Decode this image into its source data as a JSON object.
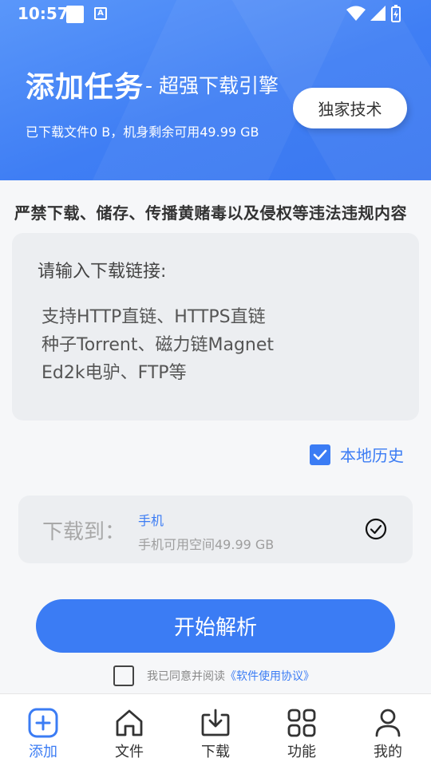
{
  "status_bar": {
    "time": "10:57"
  },
  "header": {
    "title": "添加任务",
    "subtitle": "- 超强下载引擎",
    "stats": "已下载文件0 B，机身剩余可用49.99 GB",
    "exclusive_button": "独家技术"
  },
  "warning": "严禁下载、储存、传播黄赌毒以及侵权等违法违规内容",
  "input": {
    "label": "请输入下载链接:",
    "hint_line1": "支持HTTP直链、HTTPS直链",
    "hint_line2": "种子Torrent、磁力链Magnet",
    "hint_line3": "Ed2k电驴、FTP等"
  },
  "history": {
    "label": "本地历史",
    "checked": true
  },
  "destination": {
    "label": "下载到：",
    "name": "手机",
    "space": "手机可用空间49.99 GB"
  },
  "start_button": "开始解析",
  "agreement": {
    "text": "我已同意并阅读",
    "link": "《软件使用协议》",
    "checked": false
  },
  "bottom_nav": {
    "items": [
      {
        "label": "添加",
        "icon": "add-square-icon",
        "active": true
      },
      {
        "label": "文件",
        "icon": "home-icon",
        "active": false
      },
      {
        "label": "下载",
        "icon": "download-icon",
        "active": false
      },
      {
        "label": "功能",
        "icon": "grid-icon",
        "active": false
      },
      {
        "label": "我的",
        "icon": "person-icon",
        "active": false
      }
    ]
  },
  "colors": {
    "accent": "#3b7cf4",
    "header_start": "#5a97fa",
    "header_end": "#3b78f0"
  }
}
